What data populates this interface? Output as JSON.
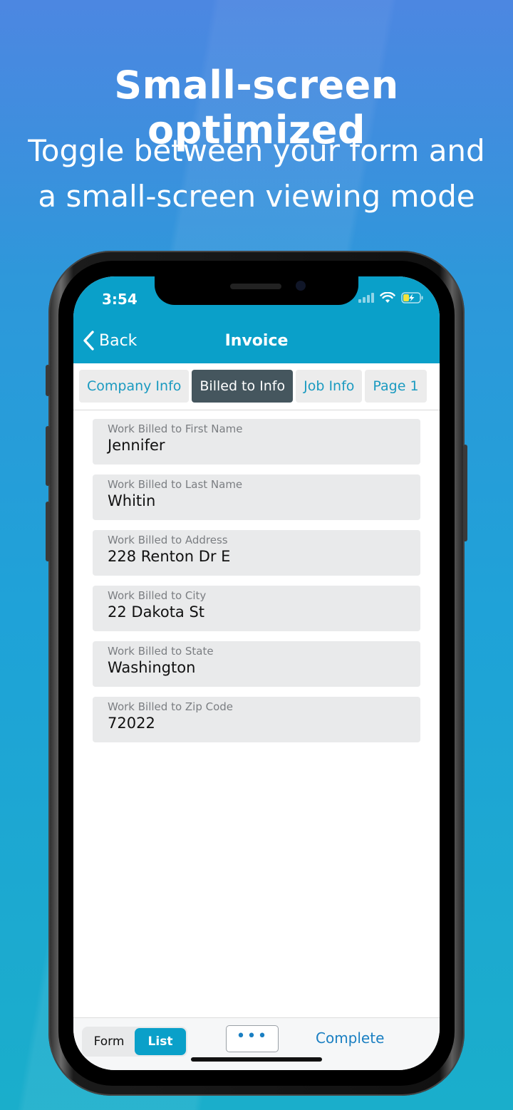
{
  "headline": "Small-screen optimized",
  "subline_1": "Toggle between your form and",
  "subline_2": "a small-screen viewing mode",
  "status": {
    "time": "3:54"
  },
  "nav": {
    "back_label": "Back",
    "title": "Invoice"
  },
  "tabs": [
    {
      "label": "Company Info",
      "active": false
    },
    {
      "label": "Billed to Info",
      "active": true
    },
    {
      "label": "Job Info",
      "active": false
    },
    {
      "label": "Page 1",
      "active": false
    }
  ],
  "fields": [
    {
      "label": "Work Billed to First Name",
      "value": "Jennifer"
    },
    {
      "label": "Work Billed to Last Name",
      "value": "Whitin"
    },
    {
      "label": "Work Billed to Address",
      "value": "228 Renton Dr E"
    },
    {
      "label": "Work Billed to City",
      "value": "22 Dakota St"
    },
    {
      "label": "Work Billed to State",
      "value": "Washington"
    },
    {
      "label": "Work Billed to Zip Code",
      "value": "72022"
    }
  ],
  "bottom": {
    "form_label": "Form",
    "list_label": "List",
    "selected_mode": "List",
    "more_label": "•••",
    "complete_label": "Complete"
  },
  "colors": {
    "accent": "#0aa0c9",
    "active_tab": "#45565e",
    "link": "#1a7fc2"
  },
  "icons": [
    "back-chevron-icon",
    "cellular-signal-icon",
    "wifi-icon",
    "battery-charging-icon"
  ]
}
